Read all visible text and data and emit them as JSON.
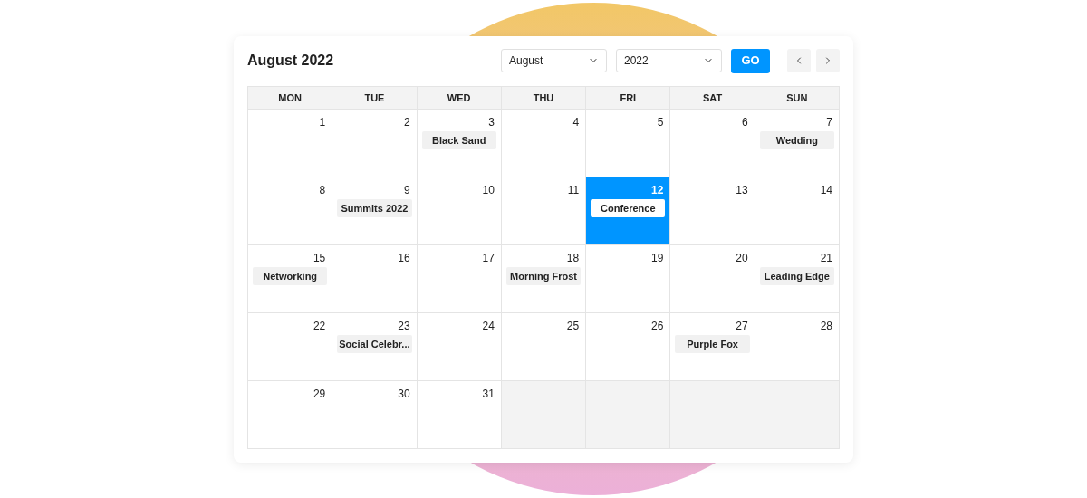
{
  "title": "August 2022",
  "month_select": {
    "value": "August"
  },
  "year_select": {
    "value": "2022"
  },
  "go_button": "GO",
  "weekdays": [
    "MON",
    "TUE",
    "WED",
    "THU",
    "FRI",
    "SAT",
    "SUN"
  ],
  "weeks": [
    [
      {
        "kind": "day",
        "day": "1",
        "selected": false
      },
      {
        "kind": "day",
        "day": "2",
        "selected": false
      },
      {
        "kind": "day",
        "day": "3",
        "selected": false,
        "event": "Black Sand"
      },
      {
        "kind": "day",
        "day": "4",
        "selected": false
      },
      {
        "kind": "day",
        "day": "5",
        "selected": false
      },
      {
        "kind": "day",
        "day": "6",
        "selected": false
      },
      {
        "kind": "day",
        "day": "7",
        "selected": false,
        "event": "Wedding"
      }
    ],
    [
      {
        "kind": "day",
        "day": "8",
        "selected": false
      },
      {
        "kind": "day",
        "day": "9",
        "selected": false,
        "event": "Summits 2022"
      },
      {
        "kind": "day",
        "day": "10",
        "selected": false
      },
      {
        "kind": "day",
        "day": "11",
        "selected": false
      },
      {
        "kind": "day",
        "day": "12",
        "selected": true,
        "event": "Conference"
      },
      {
        "kind": "day",
        "day": "13",
        "selected": false
      },
      {
        "kind": "day",
        "day": "14",
        "selected": false
      }
    ],
    [
      {
        "kind": "day",
        "day": "15",
        "selected": false,
        "event": "Networking"
      },
      {
        "kind": "day",
        "day": "16",
        "selected": false
      },
      {
        "kind": "day",
        "day": "17",
        "selected": false
      },
      {
        "kind": "day",
        "day": "18",
        "selected": false,
        "event": "Morning Frost"
      },
      {
        "kind": "day",
        "day": "19",
        "selected": false
      },
      {
        "kind": "day",
        "day": "20",
        "selected": false
      },
      {
        "kind": "day",
        "day": "21",
        "selected": false,
        "event": "Leading Edge"
      }
    ],
    [
      {
        "kind": "day",
        "day": "22",
        "selected": false
      },
      {
        "kind": "day",
        "day": "23",
        "selected": false,
        "event": "Social Celebr..."
      },
      {
        "kind": "day",
        "day": "24",
        "selected": false
      },
      {
        "kind": "day",
        "day": "25",
        "selected": false
      },
      {
        "kind": "day",
        "day": "26",
        "selected": false
      },
      {
        "kind": "day",
        "day": "27",
        "selected": false,
        "event": "Purple Fox"
      },
      {
        "kind": "day",
        "day": "28",
        "selected": false
      }
    ],
    [
      {
        "kind": "day",
        "day": "29",
        "selected": false
      },
      {
        "kind": "day",
        "day": "30",
        "selected": false
      },
      {
        "kind": "day",
        "day": "31",
        "selected": false
      },
      {
        "kind": "empty"
      },
      {
        "kind": "empty"
      },
      {
        "kind": "empty"
      },
      {
        "kind": "empty"
      }
    ]
  ]
}
